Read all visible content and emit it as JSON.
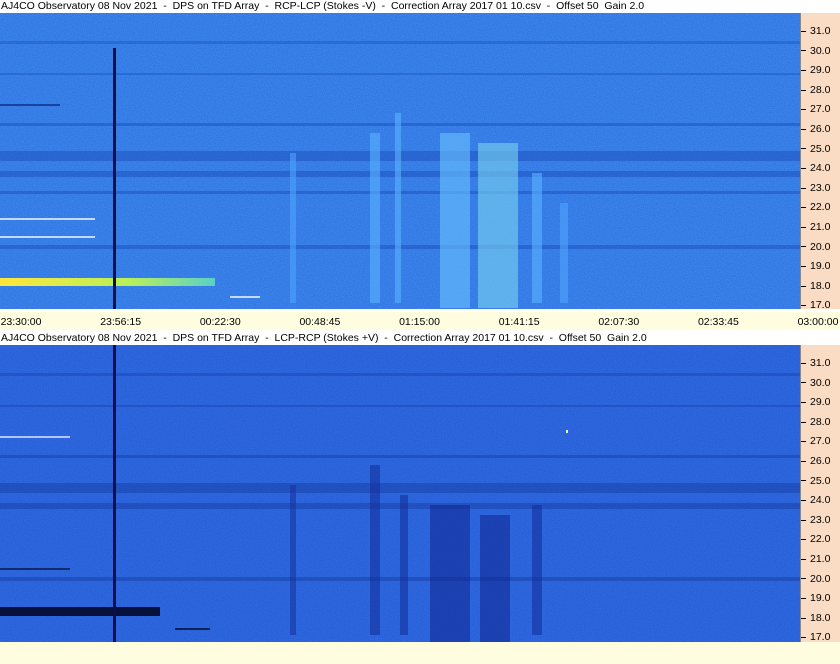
{
  "panels": [
    {
      "title": "AJ4CO Observatory 08 Nov 2021  -  DPS on TFD Array  -  RCP-LCP (Stokes -V)  -  Correction Array 2017 01 10.csv  -  Offset 50  Gain 2.0",
      "scale_labels": [
        "31.0",
        "30.0",
        "29.0",
        "28.0",
        "27.0",
        "26.0",
        "25.0",
        "24.0",
        "23.0",
        "22.0",
        "21.0",
        "20.0",
        "19.0",
        "18.0",
        "17.0"
      ]
    },
    {
      "title": "AJ4CO Observatory 08 Nov 2021  -  DPS on TFD Array  -  LCP-RCP (Stokes +V)  -  Correction Array 2017 01 10.csv  -  Offset 50  Gain 2.0",
      "scale_labels": [
        "31.0",
        "30.0",
        "29.0",
        "28.0",
        "27.0",
        "26.0",
        "25.0",
        "24.0",
        "23.0",
        "22.0",
        "21.0",
        "20.0",
        "19.0",
        "18.0",
        "17.0"
      ]
    }
  ],
  "time_axis": {
    "labels": [
      "23:30:00",
      "23:56:15",
      "00:22:30",
      "00:48:45",
      "01:15:00",
      "01:41:15",
      "02:07:30",
      "02:33:45",
      "03:00:00"
    ]
  },
  "colors": {
    "spectrogram_base": "#2b6fe0",
    "burst_hot": "#f3e43a",
    "scale_bg": "#f9dcc3",
    "timebar_bg": "#fffde0"
  }
}
